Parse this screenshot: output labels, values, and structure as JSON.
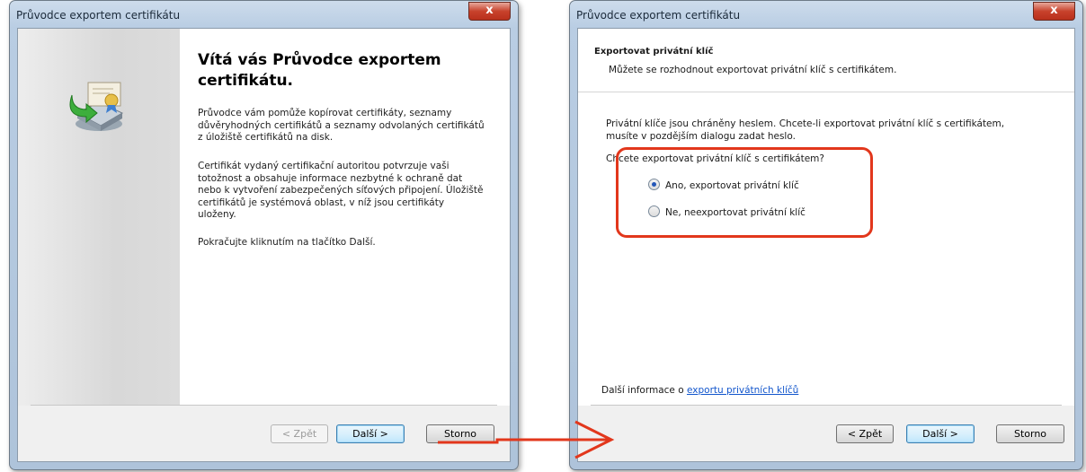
{
  "left_window": {
    "title": "Průvodce exportem certifikátu",
    "close_label": "x",
    "welcome_title": "Vítá vás Průvodce exportem certifikátu.",
    "paragraph1": "Průvodce vám pomůže kopírovat certifikáty, seznamy důvěryhodných certifikátů a seznamy odvolaných certifikátů z úložiště certifikátů na disk.",
    "paragraph2": "Certifikát vydaný certifikační autoritou potvrzuje vaši totožnost a obsahuje informace nezbytné k ochraně dat nebo k vytvoření zabezpečených síťových připojení. Úložiště certifikátů je systémová oblast, v níž jsou certifikáty uloženy.",
    "paragraph3": "Pokračujte kliknutím na tlačítko Další.",
    "buttons": {
      "back": "< Zpět",
      "next": "Další >",
      "cancel": "Storno"
    },
    "icon": "certificate-export-icon"
  },
  "right_window": {
    "title": "Průvodce exportem certifikátu",
    "close_label": "x",
    "header_title": "Exportovat privátní klíč",
    "header_subtitle": "Můžete se rozhodnout exportovat privátní klíč s certifikátem.",
    "body_text": "Privátní klíče jsou chráněny heslem. Chcete-li exportovat privátní klíč s certifikátem, musíte v pozdějším dialogu zadat heslo.",
    "question": "Chcete exportovat privátní klíč s certifikátem?",
    "options": [
      {
        "label": "Ano, exportovat privátní klíč",
        "checked": true
      },
      {
        "label": "Ne, neexportovat privátní klíč",
        "checked": false
      }
    ],
    "more_info_prefix": "Další informace o ",
    "more_info_link": "exportu privátních klíčů",
    "buttons": {
      "back": "< Zpět",
      "next": "Další >",
      "cancel": "Storno"
    }
  },
  "colors": {
    "highlight": "#e2371c",
    "link": "#1155cc",
    "accent": "#3c7fb1"
  }
}
